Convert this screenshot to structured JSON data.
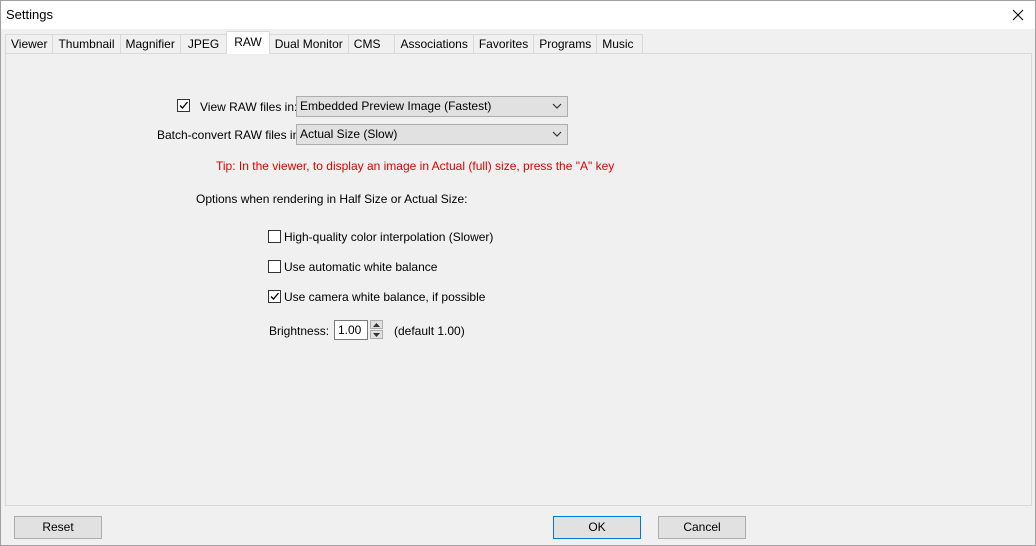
{
  "window": {
    "title": "Settings"
  },
  "tabs": [
    {
      "label": "Viewer"
    },
    {
      "label": "Thumbnail"
    },
    {
      "label": "Magnifier"
    },
    {
      "label": "JPEG"
    },
    {
      "label": "RAW"
    },
    {
      "label": "Dual Monitor"
    },
    {
      "label": "CMS"
    },
    {
      "label": "Associations"
    },
    {
      "label": "Favorites"
    },
    {
      "label": "Programs"
    },
    {
      "label": "Music"
    }
  ],
  "active_tab": "RAW",
  "raw": {
    "view_label": "View RAW files in:",
    "view_checked": true,
    "view_value": "Embedded Preview Image (Fastest)",
    "batch_label": "Batch-convert RAW files in:",
    "batch_value": "Actual Size (Slow)",
    "tip": "Tip: In the viewer, to display an image in Actual (full) size, press the \"A\" key",
    "options_heading": "Options when rendering in Half Size or Actual Size:",
    "options": [
      {
        "label": "High-quality color interpolation (Slower)",
        "checked": false
      },
      {
        "label": "Use automatic white balance",
        "checked": false
      },
      {
        "label": "Use camera white balance, if possible",
        "checked": true
      }
    ],
    "brightness_label": "Brightness:",
    "brightness_value": "1.00",
    "brightness_default": "(default 1.00)"
  },
  "footer": {
    "reset": "Reset",
    "ok": "OK",
    "cancel": "Cancel"
  }
}
